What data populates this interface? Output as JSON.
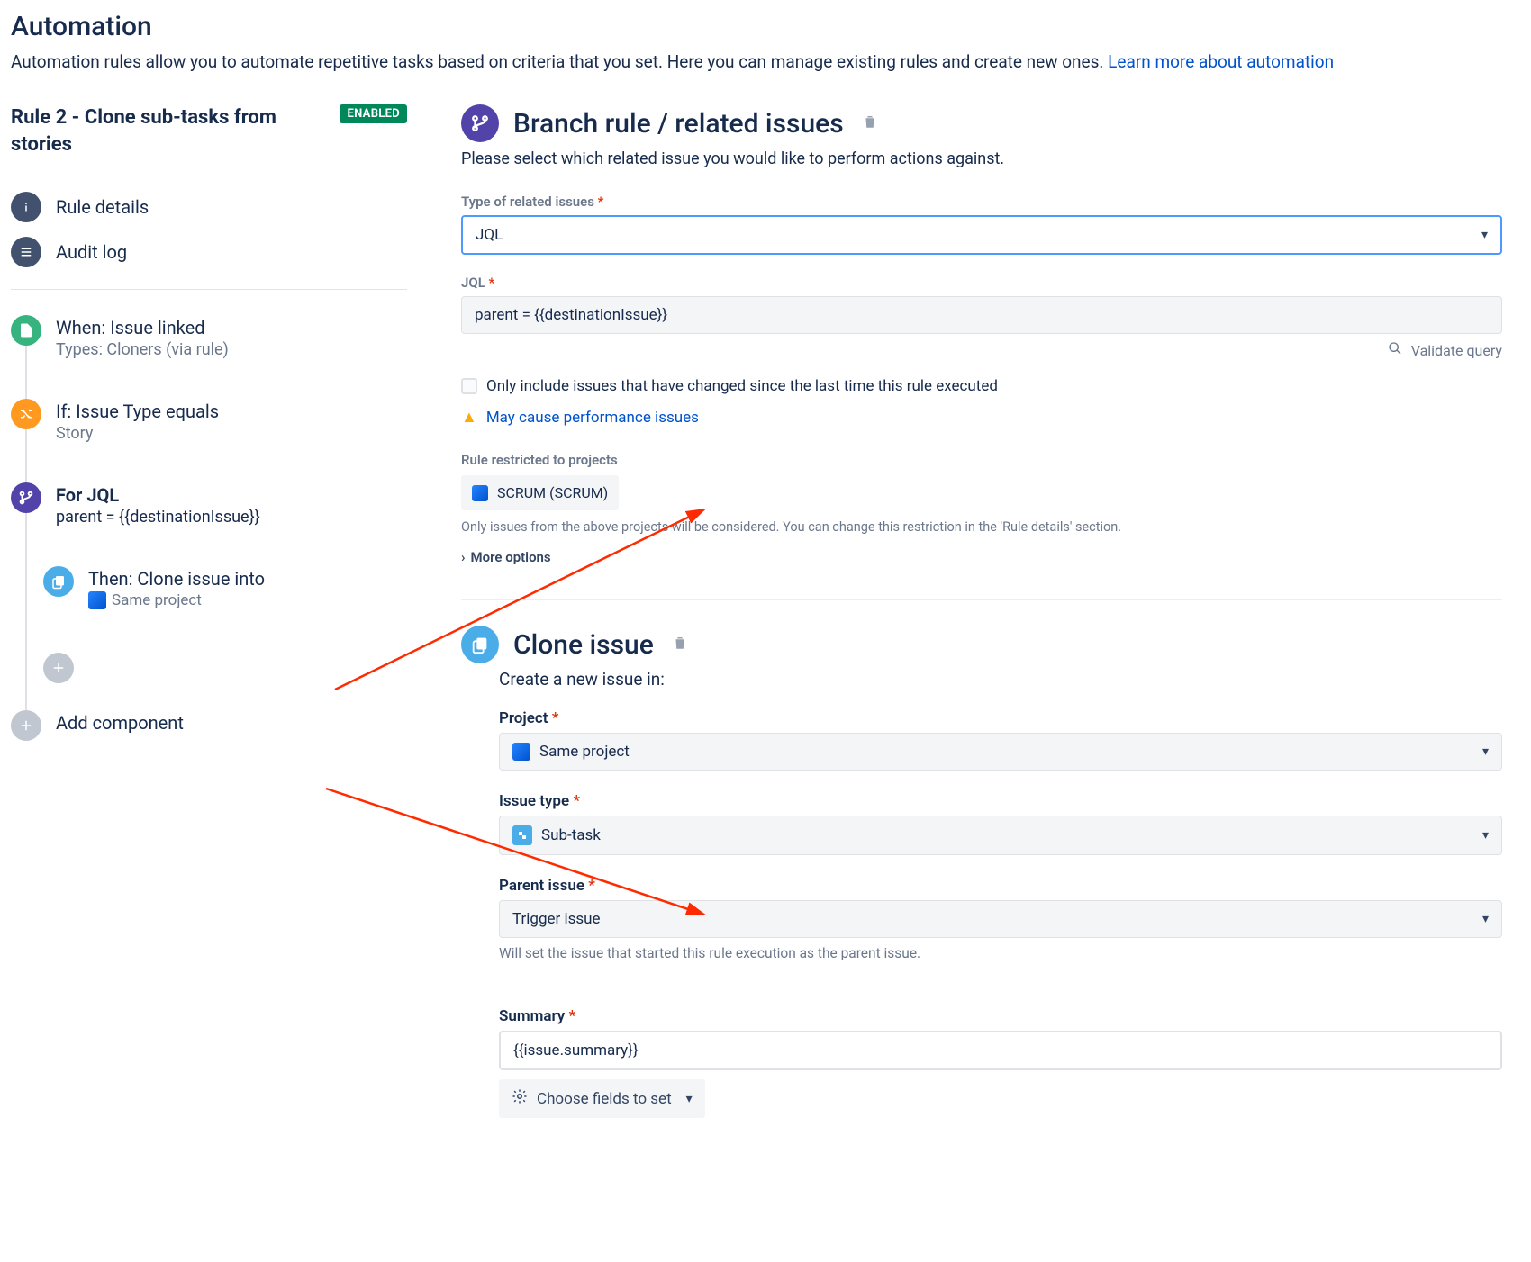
{
  "page": {
    "title": "Automation",
    "description": "Automation rules allow you to automate repetitive tasks based on criteria that you set. Here you can manage existing rules and create new ones. ",
    "learn_more": "Learn more about automation"
  },
  "rule": {
    "name": "Rule 2 - Clone sub-tasks from stories",
    "status": "ENABLED",
    "nav": {
      "details": "Rule details",
      "audit": "Audit log"
    },
    "steps": {
      "trigger": {
        "title": "When: Issue linked",
        "sub": "Types: Cloners (via rule)"
      },
      "cond": {
        "title": "If: Issue Type equals",
        "sub": "Story"
      },
      "branch": {
        "title": "For JQL",
        "sub": "parent = {{destinationIssue}}"
      },
      "action": {
        "title": "Then: Clone issue into",
        "sub": "Same project"
      },
      "add": {
        "title": "Add component"
      }
    }
  },
  "branch_panel": {
    "title": "Branch rule / related issues",
    "desc": "Please select which related issue you would like to perform actions against.",
    "type_label": "Type of related issues",
    "type_value": "JQL",
    "jql_label": "JQL",
    "jql_value": "parent = {{destinationIssue}}",
    "validate": "Validate query",
    "only_changed": "Only include issues that have changed since the last time this rule executed",
    "perf_warn": "May cause performance issues",
    "restrict_label": "Rule restricted to projects",
    "restrict_value": "SCRUM (SCRUM)",
    "restrict_note": "Only issues from the above projects will be considered. You can change this restriction in the 'Rule details' section.",
    "more": "More options"
  },
  "clone_panel": {
    "title": "Clone issue",
    "desc": "Create a new issue in:",
    "project_label": "Project",
    "project_value": "Same project",
    "issuetype_label": "Issue type",
    "issuetype_value": "Sub-task",
    "parent_label": "Parent issue",
    "parent_value": "Trigger issue",
    "parent_help": "Will set the issue that started this rule execution as the parent issue.",
    "summary_label": "Summary",
    "summary_value": "{{issue.summary}}",
    "choose_fields": "Choose fields to set"
  }
}
